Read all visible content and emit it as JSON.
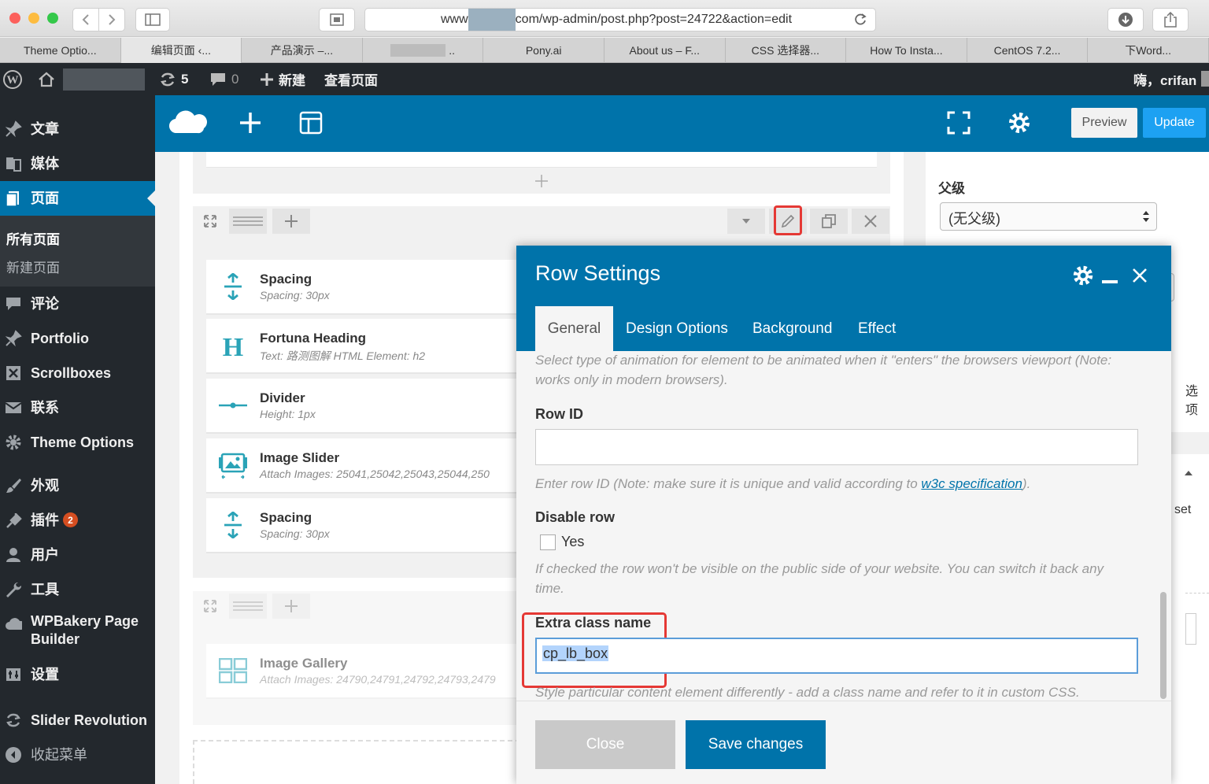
{
  "browser": {
    "url_prefix": "www",
    "url_suffix": "com/wp-admin/post.php?post=24722&action=edit",
    "tabs": [
      "Theme Optio...",
      "编辑页面 ‹...",
      "产品演示 –...",
      "..",
      "Pony.ai",
      "About us – F...",
      "CSS 选择器...",
      "How To Insta...",
      "CentOS 7.2...",
      "下Word..."
    ]
  },
  "admin_bar": {
    "updates_count": "5",
    "comments_count": "0",
    "new_label": "新建",
    "view_page_label": "查看页面",
    "greeting": "嗨，crifan"
  },
  "sidebar": {
    "items": [
      {
        "label": "文章",
        "icon": "pin-icon"
      },
      {
        "label": "媒体",
        "icon": "media-icon"
      },
      {
        "label": "页面",
        "icon": "page-icon"
      },
      {
        "label": "评论",
        "icon": "comment-icon"
      },
      {
        "label": "Portfolio",
        "icon": "pin-icon"
      },
      {
        "label": "Scrollboxes",
        "icon": "scrollbox-icon"
      },
      {
        "label": "联系",
        "icon": "mail-icon"
      },
      {
        "label": "Theme Options",
        "icon": "gear-icon"
      },
      {
        "label": "外观",
        "icon": "brush-icon"
      },
      {
        "label": "插件",
        "icon": "plugin-icon",
        "badge": "2"
      },
      {
        "label": "用户",
        "icon": "user-icon"
      },
      {
        "label": "工具",
        "icon": "wrench-icon"
      },
      {
        "label": "WPBakery Page",
        "label2": "Builder",
        "icon": "cloud-icon"
      },
      {
        "label": "设置",
        "icon": "settings-icon"
      },
      {
        "label": "Slider Revolution",
        "icon": "refresh-icon"
      },
      {
        "label": "收起菜单",
        "icon": "collapse-icon"
      }
    ],
    "submenu": [
      "所有页面",
      "新建页面"
    ]
  },
  "vc_toolbar": {
    "preview_label": "Preview",
    "update_label": "Update"
  },
  "elements": [
    {
      "title": "Spacing",
      "sub": "Spacing: 30px"
    },
    {
      "title": "Fortuna Heading",
      "sub": "Text: 路测图解 HTML Element: h2"
    },
    {
      "title": "Divider",
      "sub": "Height: 1px"
    },
    {
      "title": "Image Slider",
      "sub": "Attach Images: 25041,25042,25043,25044,250"
    },
    {
      "title": "Spacing",
      "sub": "Spacing: 30px"
    },
    {
      "title": "Image Gallery",
      "sub": "Attach Images: 24790,24791,24792,24793,2479"
    }
  ],
  "right_panel": {
    "parent_label": "父级",
    "parent_value": "(无父级)",
    "partial_text_1": "选项",
    "partial_text_2": "set"
  },
  "modal": {
    "title": "Row Settings",
    "tabs": [
      "General",
      "Design Options",
      "Background",
      "Effect"
    ],
    "animation_desc": "Select type of animation for element to be animated when it \"enters\" the browsers viewport (Note: works only in modern browsers).",
    "row_id_label": "Row ID",
    "row_id_value": "",
    "row_id_desc_pre": "Enter row ID (Note: make sure it is unique and valid according to ",
    "row_id_link": "w3c specification",
    "row_id_desc_post": ").",
    "disable_label": "Disable row",
    "disable_option": "Yes",
    "disable_desc": "If checked the row won't be visible on the public side of your website. You can switch it back any time.",
    "extra_class_label": "Extra class name",
    "extra_class_value": "cp_lb_box",
    "extra_class_desc": "Style particular content element differently - add a class name and refer to it in custom CSS.",
    "close_label": "Close",
    "save_label": "Save changes"
  },
  "colors": {
    "wp_blue": "#0073aa",
    "admin_dark": "#23282d",
    "highlight_red": "#e53935",
    "icon_teal": "#2aa3b7"
  }
}
